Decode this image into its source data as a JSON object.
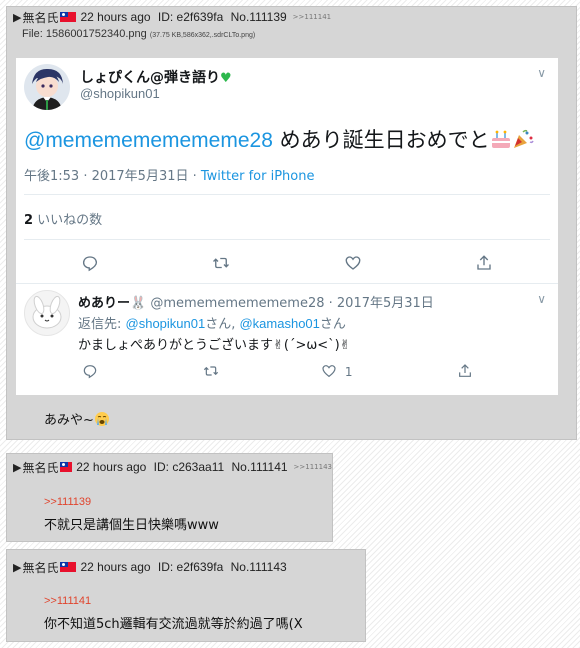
{
  "posts": [
    {
      "name": "無名氏",
      "time": "22 hours ago",
      "id": "ID: e2f639fa",
      "no": "No.111139",
      "backlinks": ">>111141",
      "file_label": "File:",
      "file_name": "1586001752340.png",
      "file_meta": "(37.75 KB,586x362,.sdrCLTo.png)",
      "comment": "あみや~"
    },
    {
      "name": "無名氏",
      "time": "22 hours ago",
      "id": "ID: c263aa11",
      "no": "No.111141",
      "backlinks": ">>111143",
      "quote": ">>111139",
      "comment": "不就只是講個生日快樂嗎www"
    },
    {
      "name": "無名氏",
      "time": "22 hours ago",
      "id": "ID: e2f639fa",
      "no": "No.111143",
      "quote": ">>111141",
      "comment": "你不知道5ch邏輯有交流過就等於約過了嗎(X"
    }
  ],
  "tweet": {
    "display_name": "しょぴくん@弾き語り",
    "handle": "@shopikun01",
    "mention": "@mememememememe28",
    "text": " めあり誕生日おめでと",
    "time": "午後1:53 · 2017年5月31日 · ",
    "source": "Twitter for iPhone",
    "likes_count": "2",
    "likes_label": " いいねの数"
  },
  "reply": {
    "display_name": "めありー",
    "handle_date": " @mememememememe28 · 2017年5月31日",
    "reply_to_label": "返信先: ",
    "reply_to_1": "@shopikun01",
    "reply_to_sep": "さん, ",
    "reply_to_2": "@kamasho01",
    "reply_to_end": "さん",
    "text": "かましょぺありがとうございます",
    "kaomoji": "(´>ω<`)",
    "like_count": "1"
  }
}
